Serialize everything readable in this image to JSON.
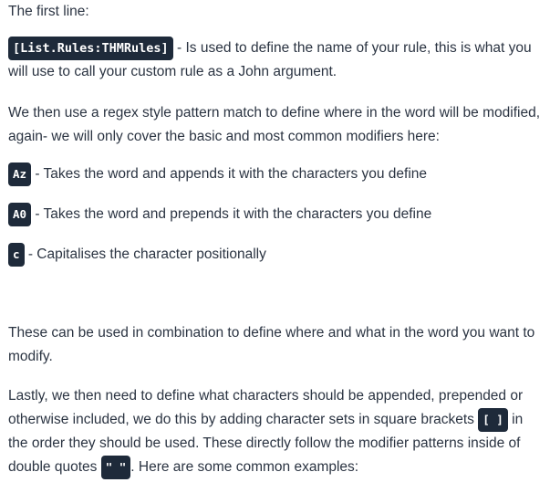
{
  "p1": {
    "text": "The first line:"
  },
  "p2": {
    "code": "[List.Rules:THMRules]",
    "text": " - Is used to define the name of your rule, this is what you will use to call your custom rule as a John argument."
  },
  "p3": {
    "text": "We then use a regex style pattern match to define where in the word will be modified, again- we will only cover the basic and most common modifiers here:"
  },
  "modifiers": [
    {
      "code": "Az",
      "text": " - Takes the word and appends it with the characters you define"
    },
    {
      "code": "A0",
      "text": " - Takes the word and prepends it with the characters you define"
    },
    {
      "code": "c",
      "text": " - Capitalises the character positionally"
    }
  ],
  "p7": {
    "text": "These can be used in combination to define where and what in the word you want to modify."
  },
  "p8": {
    "text_a": "Lastly, we then need to define what characters should be appended, prepended or otherwise included, we do this by adding character sets in square brackets ",
    "code_a": "[ ]",
    "text_b": " in the order they should be used. These directly follow the modifier patterns inside of double quotes ",
    "code_b": "\" \"",
    "text_c": ". Here are some common examples:"
  }
}
